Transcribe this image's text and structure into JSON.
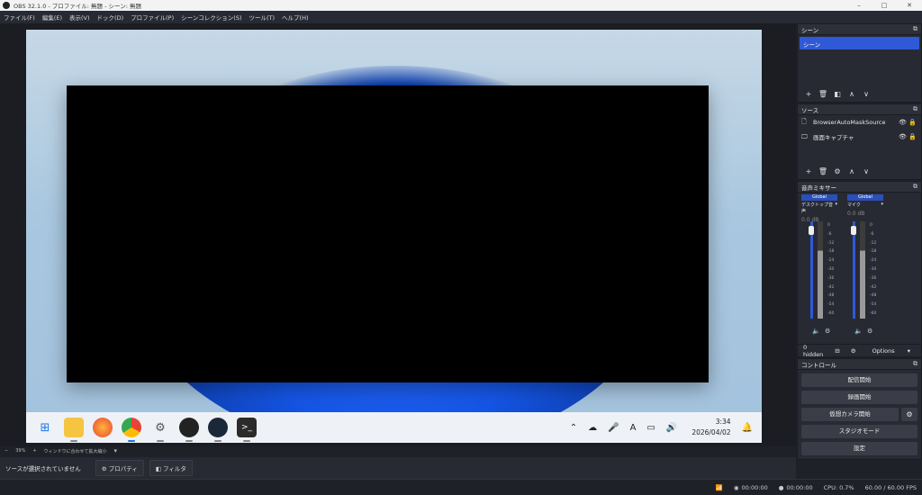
{
  "window": {
    "title": "OBS 32.1.0 - プロファイル: 無題 - シーン: 無題",
    "minimize": "–",
    "maximize": "□",
    "close": "✕"
  },
  "menu": [
    "ファイル(F)",
    "編集(E)",
    "表示(V)",
    "ドック(D)",
    "プロファイル(P)",
    "シーンコレクション(S)",
    "ツール(T)",
    "ヘルプ(H)"
  ],
  "preview": {
    "taskbar_time": "3:34",
    "taskbar_date": "2026/04/02",
    "taskbar_icons": [
      "windows-start-icon",
      "file-explorer-icon",
      "firefox-icon",
      "chrome-icon",
      "settings-icon",
      "obs-icon",
      "steam-icon",
      "terminal-icon"
    ],
    "zoom_minus": "−",
    "zoom_value": "39%",
    "zoom_plus": "+",
    "zoom_fit": "ウィンドウに合わせて拡大縮小",
    "zoom_dd": "▾"
  },
  "source_bar": {
    "status": "ソースが選択されていません",
    "properties": "プロパティ",
    "filters": "フィルタ"
  },
  "scenes": {
    "title": "シーン",
    "items": [
      "シーン"
    ]
  },
  "sources": {
    "title": "ソース",
    "items": [
      {
        "name": "BrowserAutoMaskSource",
        "icon": "document-icon"
      },
      {
        "name": "画面キャプチャ",
        "icon": "monitor-icon"
      }
    ]
  },
  "mixer": {
    "title": "音声ミキサー",
    "channels": [
      {
        "tag": "Global",
        "name": "デスクトップ音声",
        "db": "0.0 dB",
        "level": 0.7
      },
      {
        "tag": "Global",
        "name": "マイク",
        "db": "0.0 dB",
        "level": 0.45
      }
    ],
    "ticks": [
      "0",
      "-6",
      "-12",
      "-18",
      "-24",
      "-30",
      "-36",
      "-42",
      "-48",
      "-54",
      "-60"
    ],
    "hidden": "0 hidden",
    "options": "Options"
  },
  "controls": {
    "title": "コントロール",
    "buttons": [
      "配信開始",
      "録画開始",
      "仮想カメラ開始",
      "スタジオモード",
      "設定"
    ]
  },
  "status": {
    "stream_time": "00:00:00",
    "rec_time": "00:00:00",
    "cpu": "CPU: 0.7%",
    "fps": "60.00 / 60.00 FPS"
  }
}
